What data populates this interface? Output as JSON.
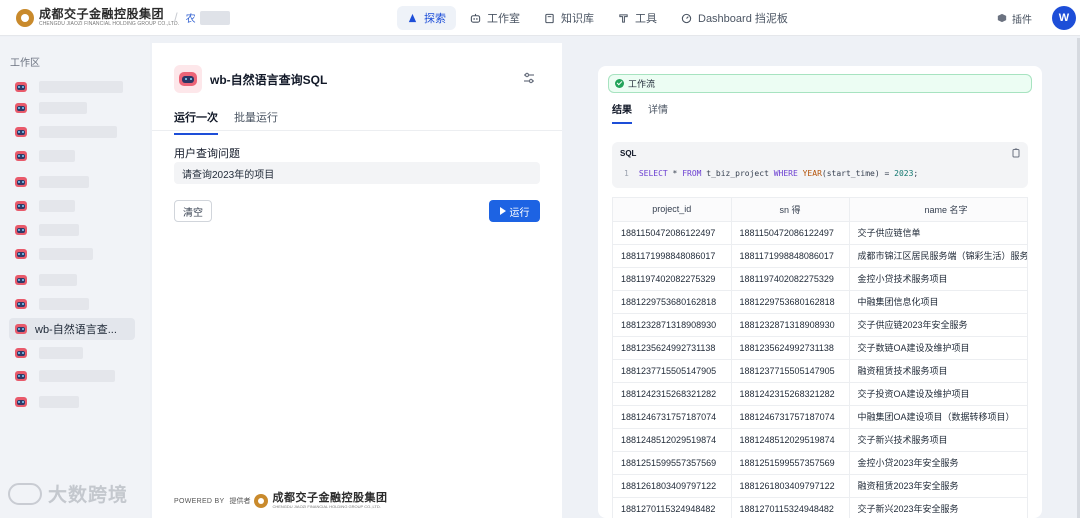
{
  "header": {
    "logo_cn": "成都交子金融控股集团",
    "logo_en": "CHENGDU JIAOZI FINANCIAL HOLDING GROUP CO.,LTD.",
    "workspace_prefix": "农",
    "nav": [
      {
        "label": "探索",
        "icon": "compass-icon",
        "active": true
      },
      {
        "label": "工作室",
        "icon": "robot-icon",
        "active": false
      },
      {
        "label": "知识库",
        "icon": "book-icon",
        "active": false
      },
      {
        "label": "工具",
        "icon": "wrench-icon",
        "active": false
      },
      {
        "label": "Dashboard 挡泥板",
        "icon": "dashboard-icon",
        "active": false
      }
    ],
    "plugin_label": "插件",
    "avatar_initial": "W"
  },
  "sidebar": {
    "title": "工作区",
    "active_item_label": "wb-自然语言查..."
  },
  "app": {
    "name": "wb-自然语言查询SQL",
    "tabs": [
      {
        "label": "运行一次",
        "active": true
      },
      {
        "label": "批量运行",
        "active": false
      }
    ],
    "field_label": "用户查询问题",
    "field_value": "请查询2023年的项目",
    "clear_label": "清空",
    "run_label": "运行",
    "powered_by": "POWERED BY",
    "provider_label": "提供者",
    "footer_logo_cn": "成都交子金融控股集团",
    "footer_logo_en": "CHENGDU JIAOZI FINANCIAL HOLDING GROUP CO.,LTD."
  },
  "result": {
    "workflow_label": "工作流",
    "tabs": [
      {
        "label": "结果",
        "active": true
      },
      {
        "label": "详情",
        "active": false
      }
    ],
    "sql_title": "SQL",
    "sql_line_no": "1",
    "sql_parts": {
      "select": "SELECT",
      "star_from": " * ",
      "from": "FROM",
      "table": " t_biz_project ",
      "where": "WHERE",
      "fn": " YEAR",
      "args": "(start_time) = ",
      "num": "2023",
      "end": ";"
    },
    "columns": [
      "project_id",
      "sn  得",
      "name  名字"
    ],
    "rows": [
      [
        "1881150472086122497",
        "1881150472086122497",
        "交子供应链信单"
      ],
      [
        "1881171998848086017",
        "1881171998848086017",
        "成都市锦江区居民服务端（锦彩生活）服务项目"
      ],
      [
        "1881197402082275329",
        "1881197402082275329",
        "金控小贷技术服务项目"
      ],
      [
        "1881229753680162818",
        "1881229753680162818",
        "中融集团信息化项目"
      ],
      [
        "1881232871318908930",
        "1881232871318908930",
        "交子供应链2023年安全服务"
      ],
      [
        "1881235624992731138",
        "1881235624992731138",
        "交子数链OA建设及维护项目"
      ],
      [
        "1881237715505147905",
        "1881237715505147905",
        "融资租赁技术服务项目"
      ],
      [
        "1881242315268321282",
        "1881242315268321282",
        "交子投资OA建设及维护项目"
      ],
      [
        "1881246731757187074",
        "1881246731757187074",
        "中融集团OA建设项目（数据转移项目）"
      ],
      [
        "1881248512029519874",
        "1881248512029519874",
        "交子新兴技术服务项目"
      ],
      [
        "1881251599557357569",
        "1881251599557357569",
        "金控小贷2023年安全服务"
      ],
      [
        "1881261803409797122",
        "1881261803409797122",
        "融资租赁2023年安全服务"
      ],
      [
        "1881270115324948482",
        "1881270115324948482",
        "交子新兴2023年安全服务"
      ]
    ]
  },
  "watermark": {
    "text": "大数跨境"
  },
  "colors": {
    "accent": "#1d63e3",
    "brand_gold": "#c98a2c",
    "success": "#22a35a"
  }
}
